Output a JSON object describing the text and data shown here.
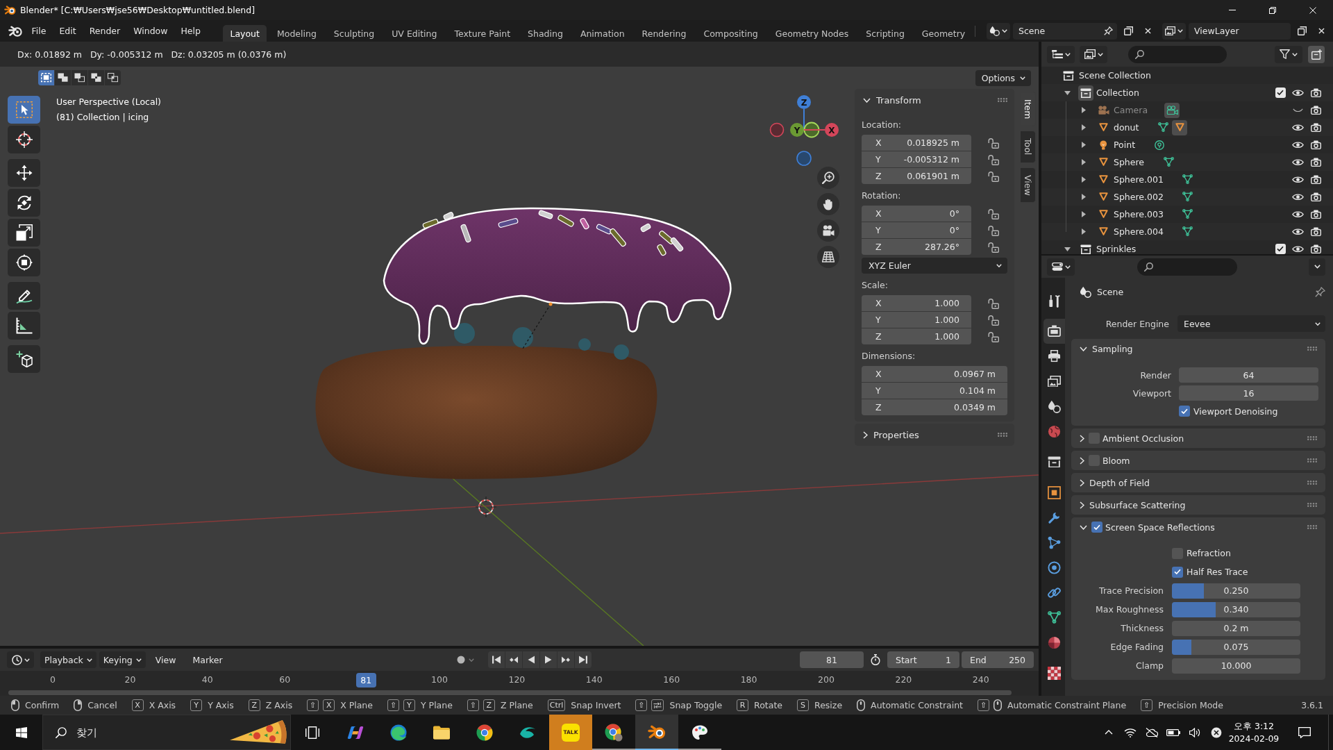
{
  "window": {
    "title": "Blender* [C:₩Users₩jse56₩Desktop₩untitled.blend]"
  },
  "menu": [
    "File",
    "Edit",
    "Render",
    "Window",
    "Help"
  ],
  "workspaces": [
    {
      "label": "Layout",
      "selected": true
    },
    {
      "label": "Modeling",
      "selected": false
    },
    {
      "label": "Sculpting",
      "selected": false
    },
    {
      "label": "UV Editing",
      "selected": false
    },
    {
      "label": "Texture Paint",
      "selected": false
    },
    {
      "label": "Shading",
      "selected": false
    },
    {
      "label": "Animation",
      "selected": false
    },
    {
      "label": "Rendering",
      "selected": false
    },
    {
      "label": "Compositing",
      "selected": false
    },
    {
      "label": "Geometry Nodes",
      "selected": false
    },
    {
      "label": "Scripting",
      "selected": false
    },
    {
      "label": "Geometry",
      "selected": false
    }
  ],
  "scene": {
    "name": "Scene"
  },
  "view_layer": {
    "name": "ViewLayer"
  },
  "viewport": {
    "transform_readout": "Dx: 0.01892 m   Dy: -0.005312 m   Dz: 0.03205 m (0.0376 m)",
    "select_modes": [
      {
        "kind": "set",
        "selected": true
      },
      {
        "kind": "extend",
        "selected": false
      },
      {
        "kind": "subtract",
        "selected": false
      },
      {
        "kind": "difference",
        "selected": false
      },
      {
        "kind": "intersect",
        "selected": false
      }
    ],
    "options": "Options",
    "info": [
      "User Perspective (Local)",
      "(81) Collection | icing"
    ],
    "tool_groups": [
      [
        {
          "kind": "select-box",
          "selected": true
        },
        {
          "kind": "cursor",
          "selected": false
        }
      ],
      [
        {
          "kind": "move",
          "selected": false
        },
        {
          "kind": "rotate",
          "selected": false
        },
        {
          "kind": "scale",
          "selected": false
        },
        {
          "kind": "transform",
          "selected": false
        }
      ],
      [
        {
          "kind": "annotate",
          "selected": false
        },
        {
          "kind": "measure",
          "selected": false
        }
      ],
      [
        {
          "kind": "add-cube",
          "selected": false
        }
      ]
    ],
    "gizmo_axes": [
      "Z",
      "Y",
      "X"
    ],
    "sidebar": {
      "tabs": [
        {
          "label": "Item",
          "selected": true
        },
        {
          "label": "Tool",
          "selected": false
        },
        {
          "label": "View",
          "selected": false
        }
      ],
      "panels": [
        {
          "title": "Transform",
          "expanded": true,
          "groups": [
            {
              "label": "Location:",
              "fields": [
                {
                  "axis": "X",
                  "value": "0.018925 m",
                  "locked": false
                },
                {
                  "axis": "Y",
                  "value": "-0.005312 m",
                  "locked": false
                },
                {
                  "axis": "Z",
                  "value": "0.061901 m",
                  "locked": false
                }
              ]
            },
            {
              "label": "Rotation:",
              "fields": [
                {
                  "axis": "X",
                  "value": "0°",
                  "locked": false
                },
                {
                  "axis": "Y",
                  "value": "0°",
                  "locked": false
                },
                {
                  "axis": "Z",
                  "value": "287.26°",
                  "locked": false
                }
              ],
              "mode": "XYZ Euler"
            },
            {
              "label": "Scale:",
              "fields": [
                {
                  "axis": "X",
                  "value": "1.000",
                  "locked": false
                },
                {
                  "axis": "Y",
                  "value": "1.000",
                  "locked": false
                },
                {
                  "axis": "Z",
                  "value": "1.000",
                  "locked": false
                }
              ]
            },
            {
              "label": "Dimensions:",
              "fields": [
                {
                  "axis": "X",
                  "value": "0.0967 m"
                },
                {
                  "axis": "Y",
                  "value": "0.104 m"
                },
                {
                  "axis": "Z",
                  "value": "0.0349 m"
                }
              ]
            }
          ]
        },
        {
          "title": "Properties",
          "expanded": false
        }
      ]
    }
  },
  "outliner": {
    "tree": [
      {
        "label": "Scene Collection",
        "kind": "scene-collection",
        "children": [
          {
            "label": "Collection",
            "kind": "collection",
            "expanded": true,
            "active": true,
            "checked": true,
            "visible": true,
            "renderable": true,
            "children": [
              {
                "label": "Camera",
                "kind": "camera",
                "expanded": false,
                "visible": false,
                "renderable": true,
                "data": [
                  {
                    "kind": "camera-data",
                    "active": true
                  }
                ]
              },
              {
                "label": "donut",
                "kind": "mesh",
                "expanded": false,
                "visible": true,
                "renderable": true,
                "data": [
                  {
                    "kind": "mesh-data",
                    "active": false
                  },
                  {
                    "kind": "mesh-object",
                    "active": true
                  }
                ]
              },
              {
                "label": "Point",
                "kind": "light",
                "expanded": false,
                "visible": true,
                "renderable": true,
                "data": [
                  {
                    "kind": "light-data",
                    "active": false
                  }
                ]
              },
              {
                "label": "Sphere",
                "kind": "mesh",
                "expanded": false,
                "visible": true,
                "renderable": true,
                "data": [
                  {
                    "kind": "mesh-data",
                    "active": false
                  }
                ]
              },
              {
                "label": "Sphere.001",
                "kind": "mesh",
                "expanded": false,
                "visible": true,
                "renderable": true,
                "data": [
                  {
                    "kind": "mesh-data",
                    "active": false
                  }
                ]
              },
              {
                "label": "Sphere.002",
                "kind": "mesh",
                "expanded": false,
                "visible": true,
                "renderable": true,
                "data": [
                  {
                    "kind": "mesh-data",
                    "active": false
                  }
                ]
              },
              {
                "label": "Sphere.003",
                "kind": "mesh",
                "expanded": false,
                "visible": true,
                "renderable": true,
                "data": [
                  {
                    "kind": "mesh-data",
                    "active": false
                  }
                ]
              },
              {
                "label": "Sphere.004",
                "kind": "mesh",
                "expanded": false,
                "visible": true,
                "renderable": true,
                "data": [
                  {
                    "kind": "mesh-data",
                    "active": false
                  }
                ]
              }
            ]
          },
          {
            "label": "Sprinkles",
            "kind": "collection",
            "expanded": true,
            "active": false,
            "checked": true,
            "visible": true,
            "renderable": true
          }
        ]
      }
    ]
  },
  "properties": {
    "tab_groups": [
      [
        {
          "kind": "tool",
          "selected": false
        }
      ],
      [
        {
          "kind": "render",
          "selected": true
        },
        {
          "kind": "output",
          "selected": false
        },
        {
          "kind": "view-layer",
          "selected": false
        },
        {
          "kind": "scene",
          "selected": false
        },
        {
          "kind": "world",
          "selected": false
        }
      ],
      [
        {
          "kind": "collection",
          "selected": false
        }
      ],
      [
        {
          "kind": "object",
          "selected": false
        },
        {
          "kind": "modifiers",
          "selected": false
        },
        {
          "kind": "particles",
          "selected": false
        },
        {
          "kind": "physics",
          "selected": false
        },
        {
          "kind": "constraints",
          "selected": false
        },
        {
          "kind": "data",
          "selected": false
        },
        {
          "kind": "material",
          "selected": false
        }
      ],
      [
        {
          "kind": "texture",
          "selected": false
        }
      ]
    ],
    "context": "Scene",
    "render_engine": {
      "label": "Render Engine",
      "value": "Eevee"
    },
    "panels": [
      {
        "title": "Sampling",
        "kind": "plain",
        "expanded": true,
        "rows": [
          {
            "kind": "number",
            "label": "Render",
            "value": "64"
          },
          {
            "kind": "number",
            "label": "Viewport",
            "value": "16"
          },
          {
            "kind": "checkbox",
            "label": "Viewport Denoising",
            "checked": true
          }
        ]
      },
      {
        "title": "Ambient Occlusion",
        "kind": "toggle",
        "checked": false,
        "expanded": false
      },
      {
        "title": "Bloom",
        "kind": "toggle",
        "checked": false,
        "expanded": false
      },
      {
        "title": "Depth of Field",
        "kind": "plain",
        "expanded": false
      },
      {
        "title": "Subsurface Scattering",
        "kind": "plain",
        "expanded": false
      },
      {
        "title": "Screen Space Reflections",
        "kind": "toggle",
        "checked": true,
        "expanded": true,
        "rows": [
          {
            "kind": "checkbox",
            "label": "Refraction",
            "checked": false
          },
          {
            "kind": "checkbox",
            "label": "Half Res Trace",
            "checked": true
          },
          {
            "kind": "slider",
            "label": "Trace Precision",
            "value": "0.250",
            "level": 0.25
          },
          {
            "kind": "slider",
            "label": "Max Roughness",
            "value": "0.340",
            "level": 0.34
          },
          {
            "kind": "number",
            "label": "Thickness",
            "value": "0.2 m"
          },
          {
            "kind": "slider",
            "label": "Edge Fading",
            "value": "0.075",
            "level": 0.15
          },
          {
            "kind": "number",
            "label": "Clamp",
            "value": "10.000"
          }
        ]
      }
    ]
  },
  "timeline": {
    "menus": [
      {
        "label": "Playback",
        "dropdown": true
      },
      {
        "label": "Keying",
        "dropdown": true
      },
      {
        "label": "View",
        "dropdown": false
      },
      {
        "label": "Marker",
        "dropdown": false
      }
    ],
    "auto_keying": false,
    "current_frame": "81",
    "start": {
      "label": "Start",
      "value": "1"
    },
    "end": {
      "label": "End",
      "value": "250"
    },
    "ruler": [
      "0",
      "20",
      "40",
      "60",
      "100",
      "120",
      "140",
      "160",
      "180",
      "200",
      "220",
      "240"
    ],
    "playhead": "81"
  },
  "status_bar": {
    "hints": [
      {
        "keys": [
          {
            "kind": "mouse-left"
          }
        ],
        "label": "Confirm"
      },
      {
        "keys": [
          {
            "kind": "mouse-right"
          }
        ],
        "label": "Cancel"
      },
      {
        "keys": [
          {
            "kind": "key",
            "text": "X"
          }
        ],
        "label": "X Axis"
      },
      {
        "keys": [
          {
            "kind": "key",
            "text": "Y"
          }
        ],
        "label": "Y Axis"
      },
      {
        "keys": [
          {
            "kind": "key",
            "text": "Z"
          }
        ],
        "label": "Z Axis"
      },
      {
        "keys": [
          {
            "kind": "key",
            "text": "⇧"
          },
          {
            "kind": "key",
            "text": "X"
          }
        ],
        "label": "X Plane"
      },
      {
        "keys": [
          {
            "kind": "key",
            "text": "⇧"
          },
          {
            "kind": "key",
            "text": "Y"
          }
        ],
        "label": "Y Plane"
      },
      {
        "keys": [
          {
            "kind": "key",
            "text": "⇧"
          },
          {
            "kind": "key",
            "text": "Z"
          }
        ],
        "label": "Z Plane"
      },
      {
        "keys": [
          {
            "kind": "key",
            "text": "Ctrl"
          }
        ],
        "label": "Snap Invert"
      },
      {
        "keys": [
          {
            "kind": "key",
            "text": "⇧"
          },
          {
            "kind": "tab-key"
          }
        ],
        "label": "Snap Toggle"
      },
      {
        "keys": [
          {
            "kind": "key",
            "text": "R"
          }
        ],
        "label": "Rotate"
      },
      {
        "keys": [
          {
            "kind": "key",
            "text": "S"
          }
        ],
        "label": "Resize"
      },
      {
        "keys": [
          {
            "kind": "mouse-middle"
          }
        ],
        "label": "Automatic Constraint"
      },
      {
        "keys": [
          {
            "kind": "key",
            "text": "⇧"
          },
          {
            "kind": "mouse-middle"
          }
        ],
        "label": "Automatic Constraint Plane"
      },
      {
        "keys": [
          {
            "kind": "key",
            "text": "⇧"
          }
        ],
        "label": "Precision Mode"
      }
    ],
    "version": "3.6.1"
  },
  "taskbar": {
    "search": {
      "placeholder": "찾기"
    },
    "apps": [
      {
        "kind": "task-view",
        "running": false,
        "selected": false,
        "flashing": false
      },
      {
        "kind": "swirl",
        "running": false,
        "selected": false,
        "flashing": false
      },
      {
        "kind": "wave-browser",
        "running": false,
        "selected": false,
        "flashing": false
      },
      {
        "kind": "folder",
        "running": false,
        "selected": false,
        "flashing": false
      },
      {
        "kind": "tricolor-browser",
        "running": false,
        "selected": false,
        "flashing": false
      },
      {
        "kind": "swoosh",
        "running": false,
        "selected": false,
        "flashing": false
      },
      {
        "kind": "talk",
        "text": "TALK",
        "running": false,
        "selected": false,
        "flashing": true
      },
      {
        "kind": "tricolor-browser-profile",
        "running": true,
        "selected": false,
        "flashing": false
      },
      {
        "kind": "orange-ring",
        "running": true,
        "selected": true,
        "flashing": false
      },
      {
        "kind": "paint",
        "running": true,
        "selected": false,
        "flashing": false
      }
    ],
    "time": "오후 3:12",
    "date": "2024-02-09"
  }
}
